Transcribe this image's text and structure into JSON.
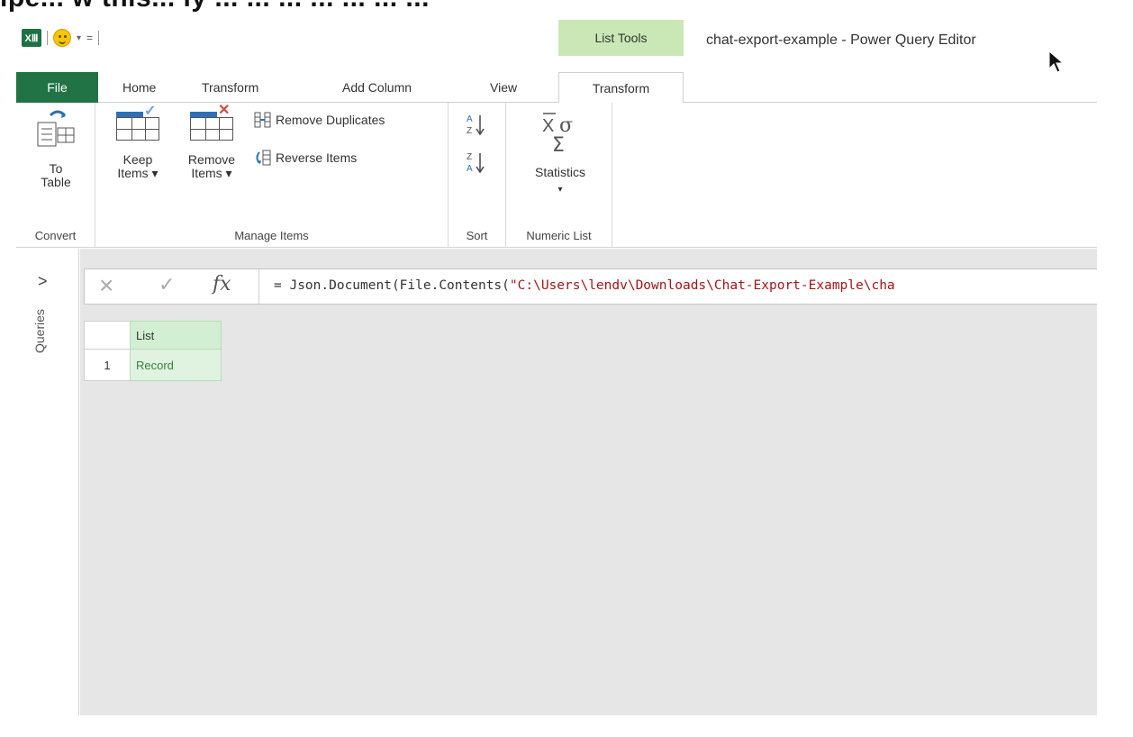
{
  "caption_fragment": "ipe... w this... ly ... ... ... ... ... ... ...",
  "qat": {
    "app_icon": "XⅢ",
    "separator": "|",
    "dropdown": "▾",
    "customize": "="
  },
  "contextual": {
    "label": "List Tools"
  },
  "window": {
    "title": "chat-export-example - Power Query Editor"
  },
  "tabs": [
    {
      "label": "File"
    },
    {
      "label": "Home"
    },
    {
      "label": "Transform"
    },
    {
      "label": "Add Column"
    },
    {
      "label": "View"
    },
    {
      "label": "Transform"
    }
  ],
  "ribbon": {
    "convert": {
      "to_table": "To Table",
      "group": "Convert"
    },
    "manage": {
      "keep_items": "Keep Items",
      "remove_items": "Remove Items",
      "remove_duplicates": "Remove Duplicates",
      "reverse_items": "Reverse Items",
      "group": "Manage Items"
    },
    "sort": {
      "asc_icon": "A↓Z",
      "desc_icon": "Z↓A",
      "group": "Sort"
    },
    "numeric": {
      "statistics": "Statistics",
      "group": "Numeric List"
    }
  },
  "left_pane": {
    "expand": ">",
    "label": "Queries"
  },
  "formula_bar": {
    "fx": "fx",
    "prefix": "= Json.Document(File.Contents(",
    "string": "\"C:\\Users\\lendv\\Downloads\\Chat-Export-Example\\cha"
  },
  "grid": {
    "header": "List",
    "rows": [
      {
        "num": "1",
        "value": "Record"
      }
    ]
  }
}
